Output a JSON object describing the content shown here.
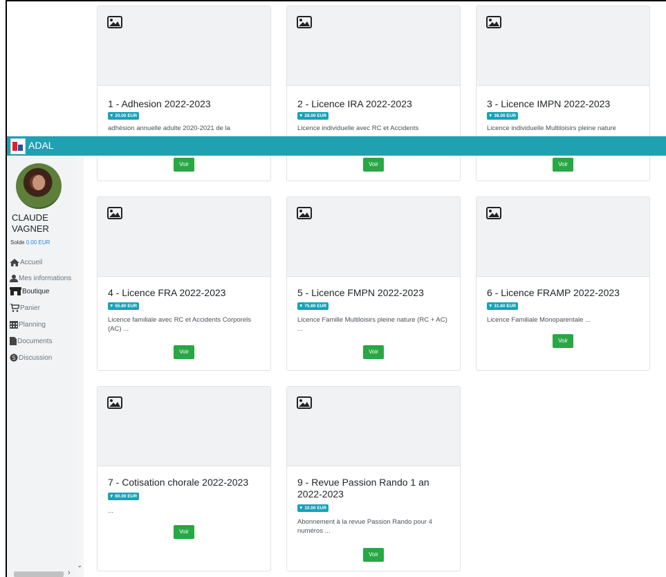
{
  "app": {
    "title": "ADAL"
  },
  "user": {
    "name": "CLAUDE VAGNER",
    "solde_label": "Solde",
    "solde_value": "0.00 EUR"
  },
  "nav": [
    {
      "label": "Accueil",
      "icon": "home-icon"
    },
    {
      "label": "Mes informations",
      "icon": "user-icon"
    },
    {
      "label": "Boutique",
      "icon": "store-icon",
      "active": true
    },
    {
      "label": "Panier",
      "icon": "cart-icon"
    },
    {
      "label": "Planning",
      "icon": "calendar-icon"
    },
    {
      "label": "Documents",
      "icon": "file-icon"
    },
    {
      "label": "Discussion",
      "icon": "chat-icon"
    }
  ],
  "products": [
    {
      "title": "1 - Adhesion 2022-2023",
      "price": "20.00 EUR",
      "description": "adhésion annuelle adulte 2020-2021 de la",
      "button": "Voir"
    },
    {
      "title": "2 - Licence IRA 2022-2023",
      "price": "28.00 EUR",
      "description": "Licence individuelle avec RC et Accidents",
      "button": "Voir"
    },
    {
      "title": "3 - Licence IMPN 2022-2023",
      "price": "38.00 EUR",
      "description": "Licence individuelle Multiloisirs pleine nature",
      "button": "Voir"
    },
    {
      "title": "4 - Licence FRA 2022-2023",
      "price": "55.80 EUR",
      "description": "Licence familiale avec RC et Accidents Corporels (AC) ...",
      "button": "Voir"
    },
    {
      "title": "5 - Licence FMPN 2022-2023",
      "price": "75.80 EUR",
      "description": "Licence Famille Multiloisirs pleine nature (RC + AC) ...",
      "button": "Voir"
    },
    {
      "title": "6 - Licence FRAMP 2022-2023",
      "price": "31.60 EUR",
      "description": "Licence Familiale Monoparentale ...",
      "button": "Voir"
    },
    {
      "title": "7 - Cotisation chorale 2022-2023",
      "price": "60.00 EUR",
      "description": "...",
      "button": "Voir"
    },
    {
      "title": "9 - Revue Passion Rando 1 an 2022-2023",
      "price": "10.00 EUR",
      "description": "Abonnement à la revue Passion Rando pour 4 numéros ...",
      "button": "Voir"
    }
  ],
  "colors": {
    "topbar": "#20a1b2",
    "price_badge": "#17a2b8",
    "button": "#28a745",
    "link": "#1e88e5"
  }
}
